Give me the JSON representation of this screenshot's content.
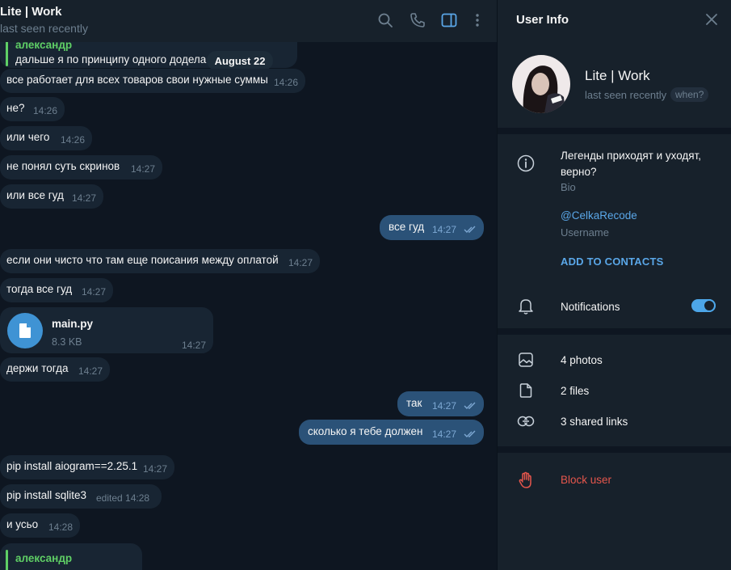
{
  "chat": {
    "title": "Lite | Work",
    "status": "last seen recently",
    "date_pill": "August 22",
    "messages": [
      {
        "id": 0,
        "type": "reply_partial",
        "reply_name": "александр",
        "reply_text": "дальше я по принципу одного додела"
      },
      {
        "id": 1,
        "type": "in",
        "text": "все работает для всех товаров свои нужные суммы",
        "time": "14:26"
      },
      {
        "id": 2,
        "type": "in",
        "text": "не?",
        "time": "14:26"
      },
      {
        "id": 3,
        "type": "in",
        "text": "или чего",
        "time": "14:26"
      },
      {
        "id": 4,
        "type": "in",
        "text": "не понял суть скринов",
        "time": "14:27"
      },
      {
        "id": 5,
        "type": "in",
        "text": "или все гуд",
        "time": "14:27"
      },
      {
        "id": 6,
        "type": "out",
        "text": "все гуд",
        "time": "14:27",
        "read": true
      },
      {
        "id": 7,
        "type": "in",
        "text": "если они чисто что там еще поисания между оплатой",
        "time": "14:27"
      },
      {
        "id": 8,
        "type": "in",
        "text": "тогда все гуд",
        "time": "14:27"
      },
      {
        "id": 9,
        "type": "file",
        "file_name": "main.py",
        "file_size": "8.3 KB",
        "time": "14:27"
      },
      {
        "id": 10,
        "type": "in",
        "text": "держи тогда",
        "time": "14:27"
      },
      {
        "id": 11,
        "type": "out",
        "text": "так",
        "time": "14:27",
        "read": true
      },
      {
        "id": 12,
        "type": "out",
        "text": "сколько я тебе должен",
        "time": "14:27",
        "read": true
      },
      {
        "id": 13,
        "type": "in",
        "text": "pip install aiogram==2.25.1",
        "time": "14:27"
      },
      {
        "id": 14,
        "type": "in",
        "text": "pip install sqlite3",
        "time": "edited 14:28"
      },
      {
        "id": 15,
        "type": "in",
        "text": "и усьо",
        "time": "14:28"
      },
      {
        "id": 16,
        "type": "reply_partial",
        "reply_name": "александр",
        "reply_text": ""
      }
    ]
  },
  "info": {
    "title": "User Info",
    "name": "Lite | Work",
    "status": "last seen recently",
    "when": "when?",
    "bio": "Легенды приходят и уходят, верно?",
    "bio_label": "Bio",
    "username": "@CelkaRecode",
    "username_label": "Username",
    "add_contact": "ADD TO CONTACTS",
    "notifications": "Notifications",
    "notifications_on": true,
    "photos": "4 photos",
    "files": "2 files",
    "links": "3 shared links",
    "block": "Block user"
  },
  "colors": {
    "accent": "#5aa7e8",
    "danger": "#e5564c",
    "reply": "#5fcf65",
    "bubble_in": "#182533",
    "bubble_out": "#2b5278"
  }
}
